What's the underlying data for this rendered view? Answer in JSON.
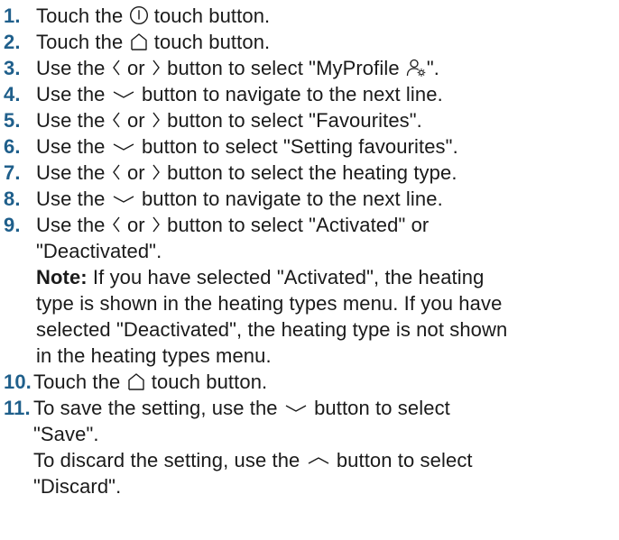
{
  "steps": [
    {
      "number": "1.",
      "segments": [
        "Touch the ",
        " touch button."
      ],
      "icon": "power-icon"
    },
    {
      "number": "2.",
      "segments": [
        "Touch the ",
        " touch button."
      ],
      "icon": "home-icon"
    },
    {
      "number": "3.",
      "segments": [
        "Use the ",
        " or ",
        " button to select \"MyProfile ",
        "\"."
      ],
      "icons": [
        "chevron-left-icon",
        "chevron-right-icon",
        "profile-settings-icon"
      ]
    },
    {
      "number": "4.",
      "segments": [
        "Use the ",
        " button to navigate to the next line."
      ],
      "icon": "chevron-down-icon"
    },
    {
      "number": "5.",
      "segments": [
        "Use the ",
        " or ",
        " button to select \"Favourites\"."
      ],
      "icons": [
        "chevron-left-icon",
        "chevron-right-icon"
      ]
    },
    {
      "number": "6.",
      "segments": [
        "Use the ",
        " button to select \"Setting favourites\"."
      ],
      "icon": "chevron-down-icon"
    },
    {
      "number": "7.",
      "segments": [
        "Use the ",
        " or ",
        " button to select the heating type."
      ],
      "icons": [
        "chevron-left-icon",
        "chevron-right-icon"
      ]
    },
    {
      "number": "8.",
      "segments": [
        "Use the ",
        " button to navigate to the next line."
      ],
      "icon": "chevron-down-icon"
    },
    {
      "number": "9.",
      "segments": [
        "Use the ",
        " or ",
        " button to select \"Activated\" or"
      ],
      "line2": "\"Deactivated\".",
      "note_label": "Note:",
      "note_lines": [
        " If you have selected \"Activated\", the heating",
        "type is shown in the heating types menu. If you have",
        "selected \"Deactivated\", the heating type is not shown",
        "in the heating types menu."
      ],
      "icons": [
        "chevron-left-icon",
        "chevron-right-icon"
      ]
    },
    {
      "number": "10.",
      "segments": [
        "Touch the ",
        " touch button."
      ],
      "icon": "home-icon"
    },
    {
      "number": "11.",
      "segments": [
        "To save the setting, use the ",
        " button to select"
      ],
      "line2": "\"Save\".",
      "line3_segments": [
        "To discard the setting, use the ",
        " button to select"
      ],
      "line4": "\"Discard\".",
      "icons": [
        "chevron-down-icon",
        "chevron-up-icon"
      ]
    }
  ],
  "colors": {
    "step_number": "#1f5f8b",
    "text": "#1a1a1a"
  }
}
